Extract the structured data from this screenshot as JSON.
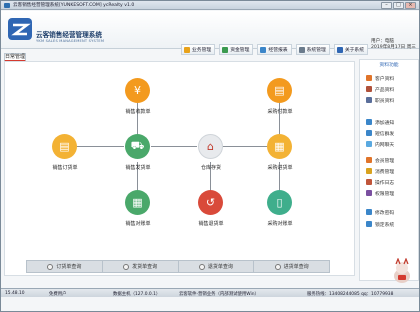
{
  "window": {
    "title": "云客销售经营管理系统[YUNKESOFT.COM] ycRealty v1.0",
    "controls": [
      "–",
      "□",
      "×"
    ]
  },
  "header": {
    "app_title": "云客销售经营管理系统",
    "app_subtitle": "YKM SALES MANAGEMENT SYSTEM",
    "nav": [
      {
        "label": "业务管理",
        "icon": "folder-icon",
        "color": "#e8a21a"
      },
      {
        "label": "资金管理",
        "icon": "money-icon",
        "color": "#3b9a4f"
      },
      {
        "label": "经营报表",
        "icon": "report-icon",
        "color": "#3b86c9"
      },
      {
        "label": "系统管理",
        "icon": "gear-icon",
        "color": "#6b7b8c"
      },
      {
        "label": "关于系统",
        "icon": "info-icon",
        "color": "#2f66b3"
      }
    ],
    "user": {
      "line1": "用户：电脑",
      "line2": "2019年8月17日 周三"
    }
  },
  "tab": {
    "label": "日常管理"
  },
  "flow": {
    "nodes": {
      "sales_receipt": {
        "label": "销售收款单",
        "icon": "yen-icon",
        "glyph": "¥",
        "color": "#f39a1e"
      },
      "purchase_payment": {
        "label": "采购付款单",
        "icon": "bill-icon",
        "glyph": "▤",
        "color": "#f39a1e"
      },
      "sales_order": {
        "label": "销售订货单",
        "icon": "order-icon",
        "glyph": "▤",
        "color": "#f3b234"
      },
      "sales_delivery": {
        "label": "销售发货单",
        "icon": "truck-icon",
        "glyph": "⛟",
        "color": "#4aa86a"
      },
      "warehouse": {
        "label": "仓库存货",
        "icon": "warehouse-icon",
        "glyph": "⌂",
        "color": "#e8eaed"
      },
      "purchase_receipt": {
        "label": "采购进货单",
        "icon": "cart-icon",
        "glyph": "▦",
        "color": "#f3b234"
      },
      "sales_reconcile": {
        "label": "销售对账单",
        "icon": "calculator-icon",
        "glyph": "▦",
        "color": "#4aa86a"
      },
      "sales_return": {
        "label": "销售退货单",
        "icon": "return-icon",
        "glyph": "↺",
        "color": "#d94a3a"
      },
      "purchase_reconcile": {
        "label": "采购对账单",
        "icon": "phone-icon",
        "glyph": "▯",
        "color": "#3fae8c"
      }
    }
  },
  "queries": [
    {
      "label": "订货单查询"
    },
    {
      "label": "发货单查询"
    },
    {
      "label": "退货单查询"
    },
    {
      "label": "进货单查询"
    }
  ],
  "sidebar": {
    "sections": [
      {
        "title": "资料功能",
        "items": [
          {
            "label": "客户资料",
            "icon": "customer-icon",
            "color": "#e0742a"
          },
          {
            "label": "产品资料",
            "icon": "product-icon",
            "color": "#b0513a"
          },
          {
            "label": "职员资料",
            "icon": "staff-icon",
            "color": "#5a6e9a"
          }
        ]
      },
      {
        "title": "",
        "items": [
          {
            "label": "添加通知",
            "icon": "add-notice-icon",
            "color": "#3b86c9"
          },
          {
            "label": "短信群发",
            "icon": "sms-icon",
            "color": "#3b86c9"
          },
          {
            "label": "内网聊天",
            "icon": "chat-icon",
            "color": "#5aa9e0"
          }
        ]
      },
      {
        "title": "",
        "items": [
          {
            "label": "会员管理",
            "icon": "member-icon",
            "color": "#e0742a"
          },
          {
            "label": "消费管理",
            "icon": "consume-icon",
            "color": "#d9a21e"
          },
          {
            "label": "操作日志",
            "icon": "log-icon",
            "color": "#c0553a"
          },
          {
            "label": "权限管理",
            "icon": "permission-icon",
            "color": "#7a4fa0"
          }
        ]
      },
      {
        "title": "",
        "items": [
          {
            "label": "修改密码",
            "icon": "password-icon",
            "color": "#3b86c9"
          },
          {
            "label": "锁定系统",
            "icon": "lock-icon",
            "color": "#3b86c9"
          }
        ]
      }
    ]
  },
  "status": {
    "version": "15.48.10",
    "user_type": "免费用户",
    "host": "数据主机（127.0.0.1）",
    "company": "云客软件·营销业务（内部测试使用Win）",
    "service": "服务热线：13408244085 qq：10779938"
  }
}
